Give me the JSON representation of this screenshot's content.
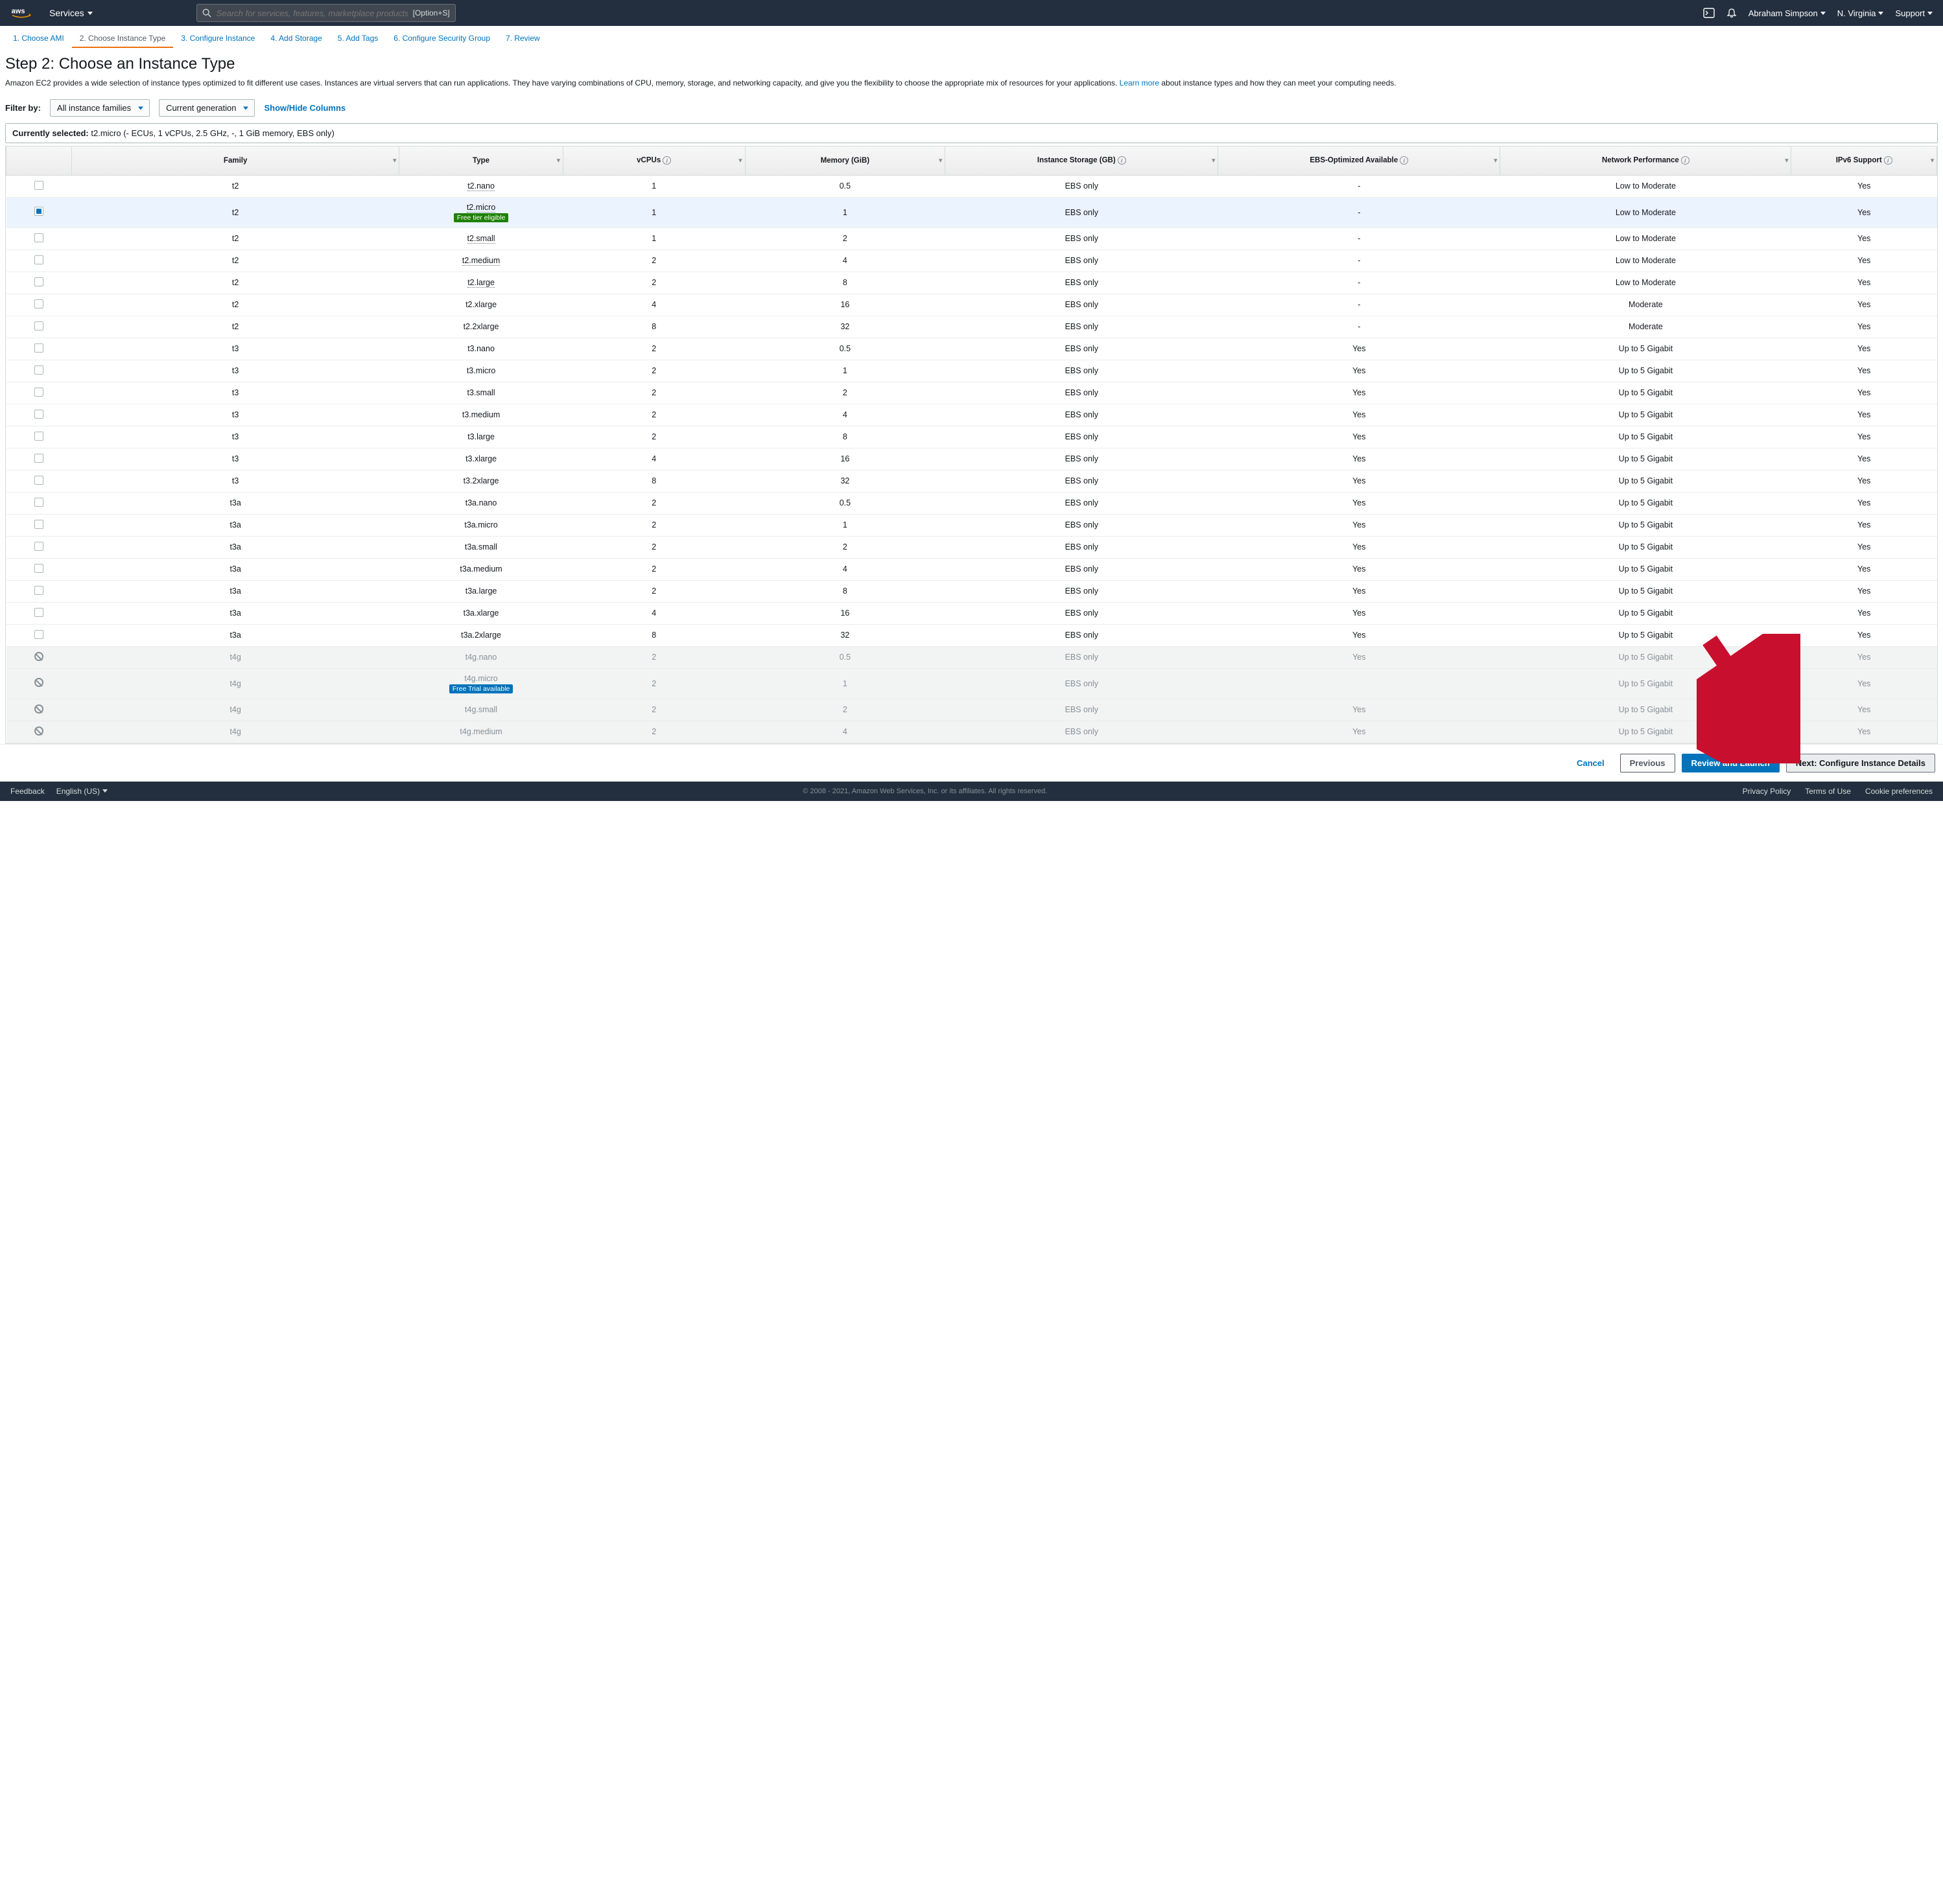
{
  "topnav": {
    "services": "Services",
    "search_placeholder": "Search for services, features, marketplace products, and docs",
    "search_shortcut": "[Option+S]",
    "user": "Abraham Simpson",
    "region": "N. Virginia",
    "support": "Support"
  },
  "wizard": {
    "tabs": [
      {
        "label": "1. Choose AMI",
        "active": false
      },
      {
        "label": "2. Choose Instance Type",
        "active": true
      },
      {
        "label": "3. Configure Instance",
        "active": false
      },
      {
        "label": "4. Add Storage",
        "active": false
      },
      {
        "label": "5. Add Tags",
        "active": false
      },
      {
        "label": "6. Configure Security Group",
        "active": false
      },
      {
        "label": "7. Review",
        "active": false
      }
    ]
  },
  "heading": "Step 2: Choose an Instance Type",
  "description": {
    "text1": "Amazon EC2 provides a wide selection of instance types optimized to fit different use cases. Instances are virtual servers that can run applications. They have varying combinations of CPU, memory, storage, and networking capacity, and give you the flexibility to choose the appropriate mix of resources for your applications. ",
    "link": "Learn more",
    "text2": " about instance types and how they can meet your computing needs."
  },
  "filter": {
    "label": "Filter by:",
    "family": "All instance families",
    "generation": "Current generation",
    "columns_link": "Show/Hide Columns"
  },
  "selected_bar": {
    "label": "Currently selected:",
    "value": "t2.micro (- ECUs, 1 vCPUs, 2.5 GHz, -, 1 GiB memory, EBS only)"
  },
  "columns": [
    "",
    "Family",
    "Type",
    "vCPUs",
    "Memory (GiB)",
    "Instance Storage (GB)",
    "EBS-Optimized Available",
    "Network Performance",
    "IPv6 Support"
  ],
  "rows": [
    {
      "sel": false,
      "disabled": false,
      "family": "t2",
      "type": "t2.nano",
      "type_dotted": true,
      "badge": null,
      "vcpus": "1",
      "memory": "0.5",
      "storage": "EBS only",
      "ebs": "-",
      "net": "Low to Moderate",
      "ipv6": "Yes"
    },
    {
      "sel": true,
      "disabled": false,
      "family": "t2",
      "type": "t2.micro",
      "type_dotted": true,
      "badge": {
        "text": "Free tier eligible",
        "cls": "green"
      },
      "vcpus": "1",
      "memory": "1",
      "storage": "EBS only",
      "ebs": "-",
      "net": "Low to Moderate",
      "ipv6": "Yes"
    },
    {
      "sel": false,
      "disabled": false,
      "family": "t2",
      "type": "t2.small",
      "type_dotted": true,
      "badge": null,
      "vcpus": "1",
      "memory": "2",
      "storage": "EBS only",
      "ebs": "-",
      "net": "Low to Moderate",
      "ipv6": "Yes"
    },
    {
      "sel": false,
      "disabled": false,
      "family": "t2",
      "type": "t2.medium",
      "type_dotted": true,
      "badge": null,
      "vcpus": "2",
      "memory": "4",
      "storage": "EBS only",
      "ebs": "-",
      "net": "Low to Moderate",
      "ipv6": "Yes"
    },
    {
      "sel": false,
      "disabled": false,
      "family": "t2",
      "type": "t2.large",
      "type_dotted": true,
      "badge": null,
      "vcpus": "2",
      "memory": "8",
      "storage": "EBS only",
      "ebs": "-",
      "net": "Low to Moderate",
      "ipv6": "Yes"
    },
    {
      "sel": false,
      "disabled": false,
      "family": "t2",
      "type": "t2.xlarge",
      "type_dotted": false,
      "badge": null,
      "vcpus": "4",
      "memory": "16",
      "storage": "EBS only",
      "ebs": "-",
      "net": "Moderate",
      "ipv6": "Yes"
    },
    {
      "sel": false,
      "disabled": false,
      "family": "t2",
      "type": "t2.2xlarge",
      "type_dotted": false,
      "badge": null,
      "vcpus": "8",
      "memory": "32",
      "storage": "EBS only",
      "ebs": "-",
      "net": "Moderate",
      "ipv6": "Yes"
    },
    {
      "sel": false,
      "disabled": false,
      "family": "t3",
      "type": "t3.nano",
      "type_dotted": false,
      "badge": null,
      "vcpus": "2",
      "memory": "0.5",
      "storage": "EBS only",
      "ebs": "Yes",
      "net": "Up to 5 Gigabit",
      "ipv6": "Yes"
    },
    {
      "sel": false,
      "disabled": false,
      "family": "t3",
      "type": "t3.micro",
      "type_dotted": false,
      "badge": null,
      "vcpus": "2",
      "memory": "1",
      "storage": "EBS only",
      "ebs": "Yes",
      "net": "Up to 5 Gigabit",
      "ipv6": "Yes"
    },
    {
      "sel": false,
      "disabled": false,
      "family": "t3",
      "type": "t3.small",
      "type_dotted": false,
      "badge": null,
      "vcpus": "2",
      "memory": "2",
      "storage": "EBS only",
      "ebs": "Yes",
      "net": "Up to 5 Gigabit",
      "ipv6": "Yes"
    },
    {
      "sel": false,
      "disabled": false,
      "family": "t3",
      "type": "t3.medium",
      "type_dotted": false,
      "badge": null,
      "vcpus": "2",
      "memory": "4",
      "storage": "EBS only",
      "ebs": "Yes",
      "net": "Up to 5 Gigabit",
      "ipv6": "Yes"
    },
    {
      "sel": false,
      "disabled": false,
      "family": "t3",
      "type": "t3.large",
      "type_dotted": false,
      "badge": null,
      "vcpus": "2",
      "memory": "8",
      "storage": "EBS only",
      "ebs": "Yes",
      "net": "Up to 5 Gigabit",
      "ipv6": "Yes"
    },
    {
      "sel": false,
      "disabled": false,
      "family": "t3",
      "type": "t3.xlarge",
      "type_dotted": false,
      "badge": null,
      "vcpus": "4",
      "memory": "16",
      "storage": "EBS only",
      "ebs": "Yes",
      "net": "Up to 5 Gigabit",
      "ipv6": "Yes"
    },
    {
      "sel": false,
      "disabled": false,
      "family": "t3",
      "type": "t3.2xlarge",
      "type_dotted": false,
      "badge": null,
      "vcpus": "8",
      "memory": "32",
      "storage": "EBS only",
      "ebs": "Yes",
      "net": "Up to 5 Gigabit",
      "ipv6": "Yes"
    },
    {
      "sel": false,
      "disabled": false,
      "family": "t3a",
      "type": "t3a.nano",
      "type_dotted": false,
      "badge": null,
      "vcpus": "2",
      "memory": "0.5",
      "storage": "EBS only",
      "ebs": "Yes",
      "net": "Up to 5 Gigabit",
      "ipv6": "Yes"
    },
    {
      "sel": false,
      "disabled": false,
      "family": "t3a",
      "type": "t3a.micro",
      "type_dotted": false,
      "badge": null,
      "vcpus": "2",
      "memory": "1",
      "storage": "EBS only",
      "ebs": "Yes",
      "net": "Up to 5 Gigabit",
      "ipv6": "Yes"
    },
    {
      "sel": false,
      "disabled": false,
      "family": "t3a",
      "type": "t3a.small",
      "type_dotted": false,
      "badge": null,
      "vcpus": "2",
      "memory": "2",
      "storage": "EBS only",
      "ebs": "Yes",
      "net": "Up to 5 Gigabit",
      "ipv6": "Yes"
    },
    {
      "sel": false,
      "disabled": false,
      "family": "t3a",
      "type": "t3a.medium",
      "type_dotted": false,
      "badge": null,
      "vcpus": "2",
      "memory": "4",
      "storage": "EBS only",
      "ebs": "Yes",
      "net": "Up to 5 Gigabit",
      "ipv6": "Yes"
    },
    {
      "sel": false,
      "disabled": false,
      "family": "t3a",
      "type": "t3a.large",
      "type_dotted": false,
      "badge": null,
      "vcpus": "2",
      "memory": "8",
      "storage": "EBS only",
      "ebs": "Yes",
      "net": "Up to 5 Gigabit",
      "ipv6": "Yes"
    },
    {
      "sel": false,
      "disabled": false,
      "family": "t3a",
      "type": "t3a.xlarge",
      "type_dotted": false,
      "badge": null,
      "vcpus": "4",
      "memory": "16",
      "storage": "EBS only",
      "ebs": "Yes",
      "net": "Up to 5 Gigabit",
      "ipv6": "Yes"
    },
    {
      "sel": false,
      "disabled": false,
      "family": "t3a",
      "type": "t3a.2xlarge",
      "type_dotted": false,
      "badge": null,
      "vcpus": "8",
      "memory": "32",
      "storage": "EBS only",
      "ebs": "Yes",
      "net": "Up to 5 Gigabit",
      "ipv6": "Yes"
    },
    {
      "sel": false,
      "disabled": true,
      "family": "t4g",
      "type": "t4g.nano",
      "type_dotted": false,
      "badge": null,
      "vcpus": "2",
      "memory": "0.5",
      "storage": "EBS only",
      "ebs": "Yes",
      "net": "Up to 5 Gigabit",
      "ipv6": "Yes"
    },
    {
      "sel": false,
      "disabled": true,
      "family": "t4g",
      "type": "t4g.micro",
      "type_dotted": false,
      "badge": {
        "text": "Free Trial available",
        "cls": "blue"
      },
      "vcpus": "2",
      "memory": "1",
      "storage": "EBS only",
      "ebs": "",
      "net": "Up to 5 Gigabit",
      "ipv6": "Yes"
    },
    {
      "sel": false,
      "disabled": true,
      "family": "t4g",
      "type": "t4g.small",
      "type_dotted": false,
      "badge": null,
      "vcpus": "2",
      "memory": "2",
      "storage": "EBS only",
      "ebs": "Yes",
      "net": "Up to 5 Gigabit",
      "ipv6": "Yes"
    },
    {
      "sel": false,
      "disabled": true,
      "family": "t4g",
      "type": "t4g.medium",
      "type_dotted": false,
      "badge": null,
      "vcpus": "2",
      "memory": "4",
      "storage": "EBS only",
      "ebs": "Yes",
      "net": "Up to 5 Gigabit",
      "ipv6": "Yes"
    }
  ],
  "footer_buttons": {
    "cancel": "Cancel",
    "previous": "Previous",
    "review": "Review and Launch",
    "next": "Next: Configure Instance Details"
  },
  "bottombar": {
    "feedback": "Feedback",
    "language": "English (US)",
    "copyright": "© 2008 - 2021, Amazon Web Services, Inc. or its affiliates. All rights reserved.",
    "privacy": "Privacy Policy",
    "terms": "Terms of Use",
    "cookies": "Cookie preferences"
  }
}
